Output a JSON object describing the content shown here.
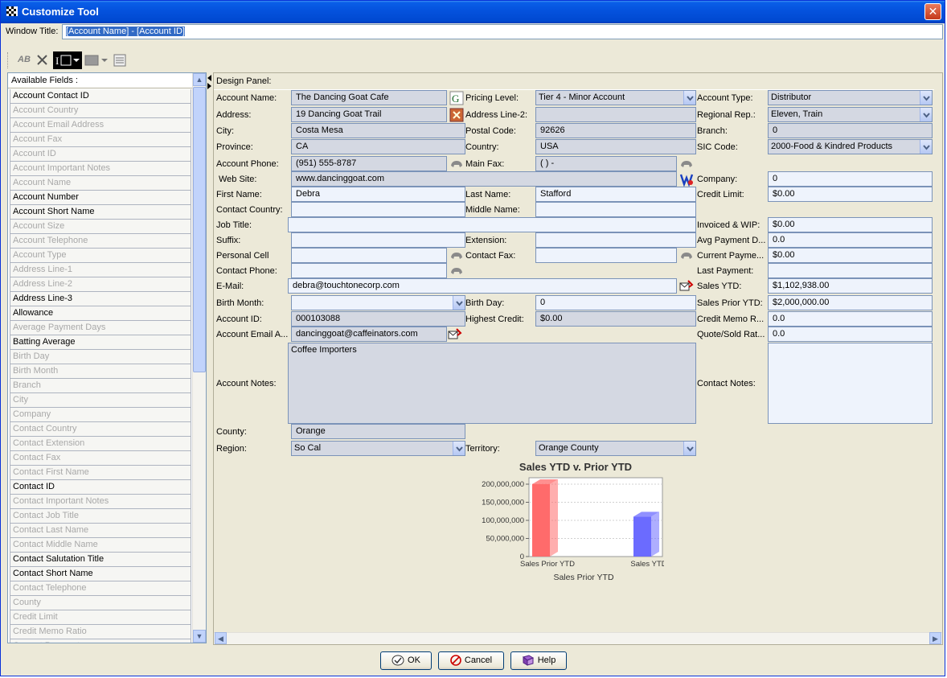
{
  "window": {
    "title": "Customize Tool",
    "close_glyph": "✕"
  },
  "window_title_row": {
    "label": "Window Title:",
    "value": "[Account Name] - [Account ID]"
  },
  "toolbar": {
    "icons": [
      "ab-rename-icon",
      "delete-icon",
      "text-field-icon",
      "color-icon",
      "align-icon"
    ],
    "ab_text": "AB"
  },
  "fields": {
    "title": "Available Fields :",
    "items": [
      {
        "label": "Account Contact ID",
        "enabled": true
      },
      {
        "label": "Account Country",
        "enabled": false
      },
      {
        "label": "Account Email Address",
        "enabled": false
      },
      {
        "label": "Account Fax",
        "enabled": false
      },
      {
        "label": "Account ID",
        "enabled": false
      },
      {
        "label": "Account Important Notes",
        "enabled": false
      },
      {
        "label": "Account Name",
        "enabled": false
      },
      {
        "label": "Account Number",
        "enabled": true
      },
      {
        "label": "Account Short Name",
        "enabled": true
      },
      {
        "label": "Account Size",
        "enabled": false
      },
      {
        "label": "Account Telephone",
        "enabled": false
      },
      {
        "label": "Account Type",
        "enabled": false
      },
      {
        "label": "Address Line-1",
        "enabled": false
      },
      {
        "label": "Address Line-2",
        "enabled": false
      },
      {
        "label": "Address Line-3",
        "enabled": true
      },
      {
        "label": "Allowance",
        "enabled": true
      },
      {
        "label": "Average Payment Days",
        "enabled": false
      },
      {
        "label": "Batting Average",
        "enabled": true
      },
      {
        "label": "Birth Day",
        "enabled": false
      },
      {
        "label": "Birth Month",
        "enabled": false
      },
      {
        "label": "Branch",
        "enabled": false
      },
      {
        "label": "City",
        "enabled": false
      },
      {
        "label": "Company",
        "enabled": false
      },
      {
        "label": "Contact Country",
        "enabled": false
      },
      {
        "label": "Contact Extension",
        "enabled": false
      },
      {
        "label": "Contact Fax",
        "enabled": false
      },
      {
        "label": "Contact First Name",
        "enabled": false
      },
      {
        "label": "Contact ID",
        "enabled": true
      },
      {
        "label": "Contact Important Notes",
        "enabled": false
      },
      {
        "label": "Contact Job Title",
        "enabled": false
      },
      {
        "label": "Contact Last Name",
        "enabled": false
      },
      {
        "label": "Contact Middle Name",
        "enabled": false
      },
      {
        "label": "Contact Salutation Title",
        "enabled": true
      },
      {
        "label": "Contact Short Name",
        "enabled": true
      },
      {
        "label": "Contact Telephone",
        "enabled": false
      },
      {
        "label": "County",
        "enabled": false
      },
      {
        "label": "Credit Limit",
        "enabled": false
      },
      {
        "label": "Credit Memo Ratio",
        "enabled": false
      },
      {
        "label": "Current Payment",
        "enabled": false
      }
    ]
  },
  "design": {
    "title": "Design Panel:",
    "labels": {
      "account_name": "Account Name:",
      "address": "Address:",
      "city": "City:",
      "province": "Province:",
      "account_phone": "Account Phone:",
      "web_site": "Web Site:",
      "first_name": "First Name:",
      "contact_country": "Contact Country:",
      "job_title": "Job Title:",
      "suffix": "Suffix:",
      "personal_cell": "Personal Cell",
      "contact_phone": "Contact Phone:",
      "email": "E-Mail:",
      "birth_month": "Birth Month:",
      "account_id": "Account ID:",
      "account_email": "Account Email A...",
      "account_notes": "Account Notes:",
      "county": "County:",
      "region": "Region:",
      "pricing_level": "Pricing Level:",
      "address_line2": "Address Line-2:",
      "postal_code": "Postal Code:",
      "country": "Country:",
      "main_fax": "Main Fax:",
      "last_name": "Last Name:",
      "middle_name": "Middle Name:",
      "extension": "Extension:",
      "contact_fax": "Contact Fax:",
      "birth_day": "Birth Day:",
      "highest_credit": "Highest Credit:",
      "territory": "Territory:",
      "account_type": "Account Type:",
      "regional_rep": "Regional Rep.:",
      "branch": "Branch:",
      "sic_code": "SIC Code:",
      "company": "Company:",
      "credit_limit": "Credit Limit:",
      "invoiced_wip": "Invoiced & WIP:",
      "avg_payment": "Avg Payment D...",
      "current_payment": "Current Payme...",
      "last_payment": "Last Payment:",
      "sales_ytd": "Sales YTD:",
      "sales_prior_ytd": "Sales Prior YTD:",
      "credit_memo": "Credit Memo R...",
      "quote_sold": "Quote/Sold Rat...",
      "contact_notes": "Contact Notes:"
    },
    "values": {
      "account_name": "The Dancing Goat Cafe",
      "address": "19 Dancing Goat Trail",
      "city": "Costa Mesa",
      "province": "CA",
      "account_phone": "(951) 555-8787",
      "web_site": "www.dancinggoat.com",
      "first_name": "Debra",
      "contact_country": "",
      "job_title": "",
      "suffix": "",
      "personal_cell": "",
      "contact_phone": "",
      "email": "debra@touchtonecorp.com",
      "birth_month": "",
      "account_id": "000103088",
      "account_email": "dancinggoat@caffeinators.com",
      "account_notes": "Coffee Importers",
      "county": "Orange",
      "region": "So Cal",
      "pricing_level": "Tier 4 - Minor Account",
      "address_line2": "",
      "postal_code": "92626",
      "country": "USA",
      "main_fax": "(   )   -",
      "last_name": "Stafford",
      "middle_name": "",
      "extension": "",
      "contact_fax": "",
      "birth_day": "0",
      "highest_credit": "$0.00",
      "territory": "Orange County",
      "account_type": "Distributor",
      "regional_rep": "Eleven, Train",
      "branch": "0",
      "sic_code": "2000-Food & Kindred Products",
      "company": "0",
      "credit_limit": "$0.00",
      "invoiced_wip": "$0.00",
      "avg_payment": "0.0",
      "current_payment": "$0.00",
      "last_payment": "",
      "sales_ytd": "$1,102,938.00",
      "sales_prior_ytd": "$2,000,000.00",
      "credit_memo": "0.0",
      "quote_sold": "0.0",
      "contact_notes": ""
    }
  },
  "chart_data": {
    "type": "bar",
    "title": "Sales YTD v. Prior YTD",
    "categories": [
      "Sales Prior YTD",
      "Sales YTD"
    ],
    "values": [
      200000000,
      110293800
    ],
    "colors": [
      "#ff6b6b",
      "#6b6bff"
    ],
    "xlabel": "Sales Prior YTD",
    "ylabel": "",
    "yticks": [
      "0",
      "50,000,000",
      "100,000,000",
      "150,000,000",
      "200,000,000"
    ],
    "ylim": [
      0,
      200000000
    ],
    "grid": true
  },
  "buttons": {
    "ok": "OK",
    "cancel": "Cancel",
    "help": "Help"
  }
}
